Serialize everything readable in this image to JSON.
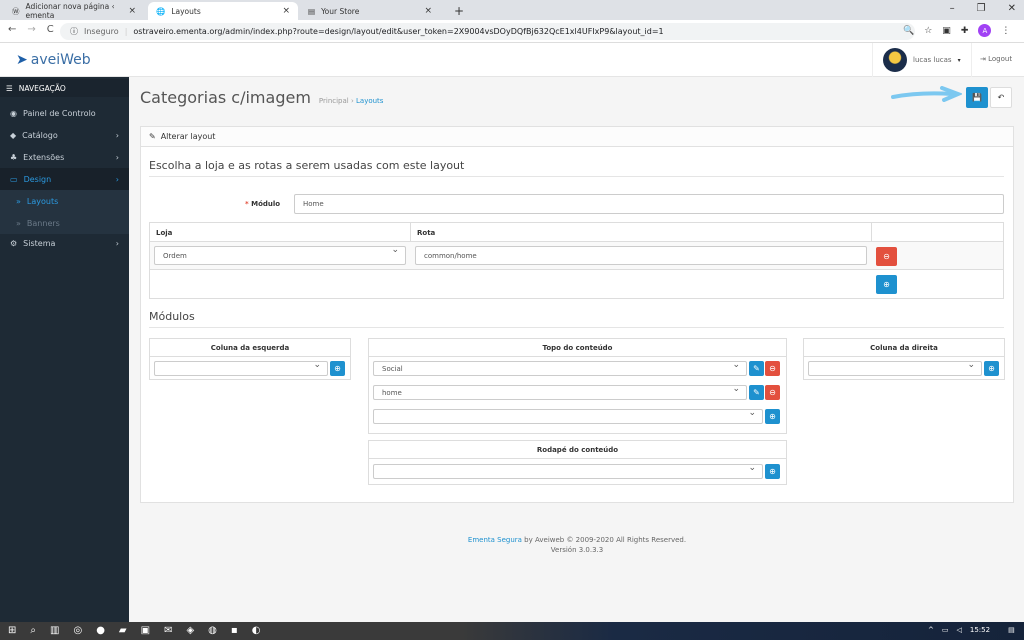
{
  "browser": {
    "tabs": [
      {
        "label": "Adicionar nova página ‹ ementa"
      },
      {
        "label": "Layouts"
      },
      {
        "label": "Your Store"
      }
    ],
    "insecure": "Inseguro",
    "url": "ostraveiro.ementa.org/admin/index.php?route=design/layout/edit&user_token=2X9004vsDOyDQfBj632QcE1xl4UFIxP9&layout_id=1",
    "profile_initial": "A"
  },
  "header": {
    "logo": "aveiWeb",
    "user": "lucas lucas",
    "logout": "Logout"
  },
  "sidebar": {
    "title": "NAVEGAÇÃO",
    "items": [
      {
        "label": "Painel de Controlo"
      },
      {
        "label": "Catálogo"
      },
      {
        "label": "Extensões"
      },
      {
        "label": "Design"
      },
      {
        "label": "Layouts"
      },
      {
        "label": "Banners"
      },
      {
        "label": "Sistema"
      }
    ]
  },
  "page": {
    "title": "Categorias c/imagem",
    "breadcrumb": [
      "Principal",
      "Layouts"
    ]
  },
  "panel": {
    "heading": "Alterar layout",
    "legend": "Escolha a loja e as rotas a serem usadas com este layout",
    "modulo_label": "Módulo",
    "modulo_value": "Home",
    "table": {
      "headers": [
        "Loja",
        "Rota"
      ],
      "rows": [
        {
          "loja": "Ordem",
          "rota": "common/home"
        }
      ]
    },
    "modules_legend": "Módulos",
    "left": {
      "title": "Coluna da esquerda"
    },
    "top": {
      "title": "Topo do conteúdo",
      "items": [
        "Social",
        "home"
      ]
    },
    "right": {
      "title": "Coluna da direita"
    },
    "bottom": {
      "title": "Rodapé do conteúdo"
    }
  },
  "footer": {
    "link": "Ementa Segura",
    "text": " by Aveiweb © 2009-2020 All Rights Reserved.",
    "version": "Versión 3.0.3.3"
  },
  "taskbar": {
    "time": "15:52"
  },
  "colors": {
    "primary": "#1e91cf",
    "danger": "#e3503e",
    "sidebar": "#1e2a35",
    "annotation_arrow": "#7cc8f0"
  }
}
